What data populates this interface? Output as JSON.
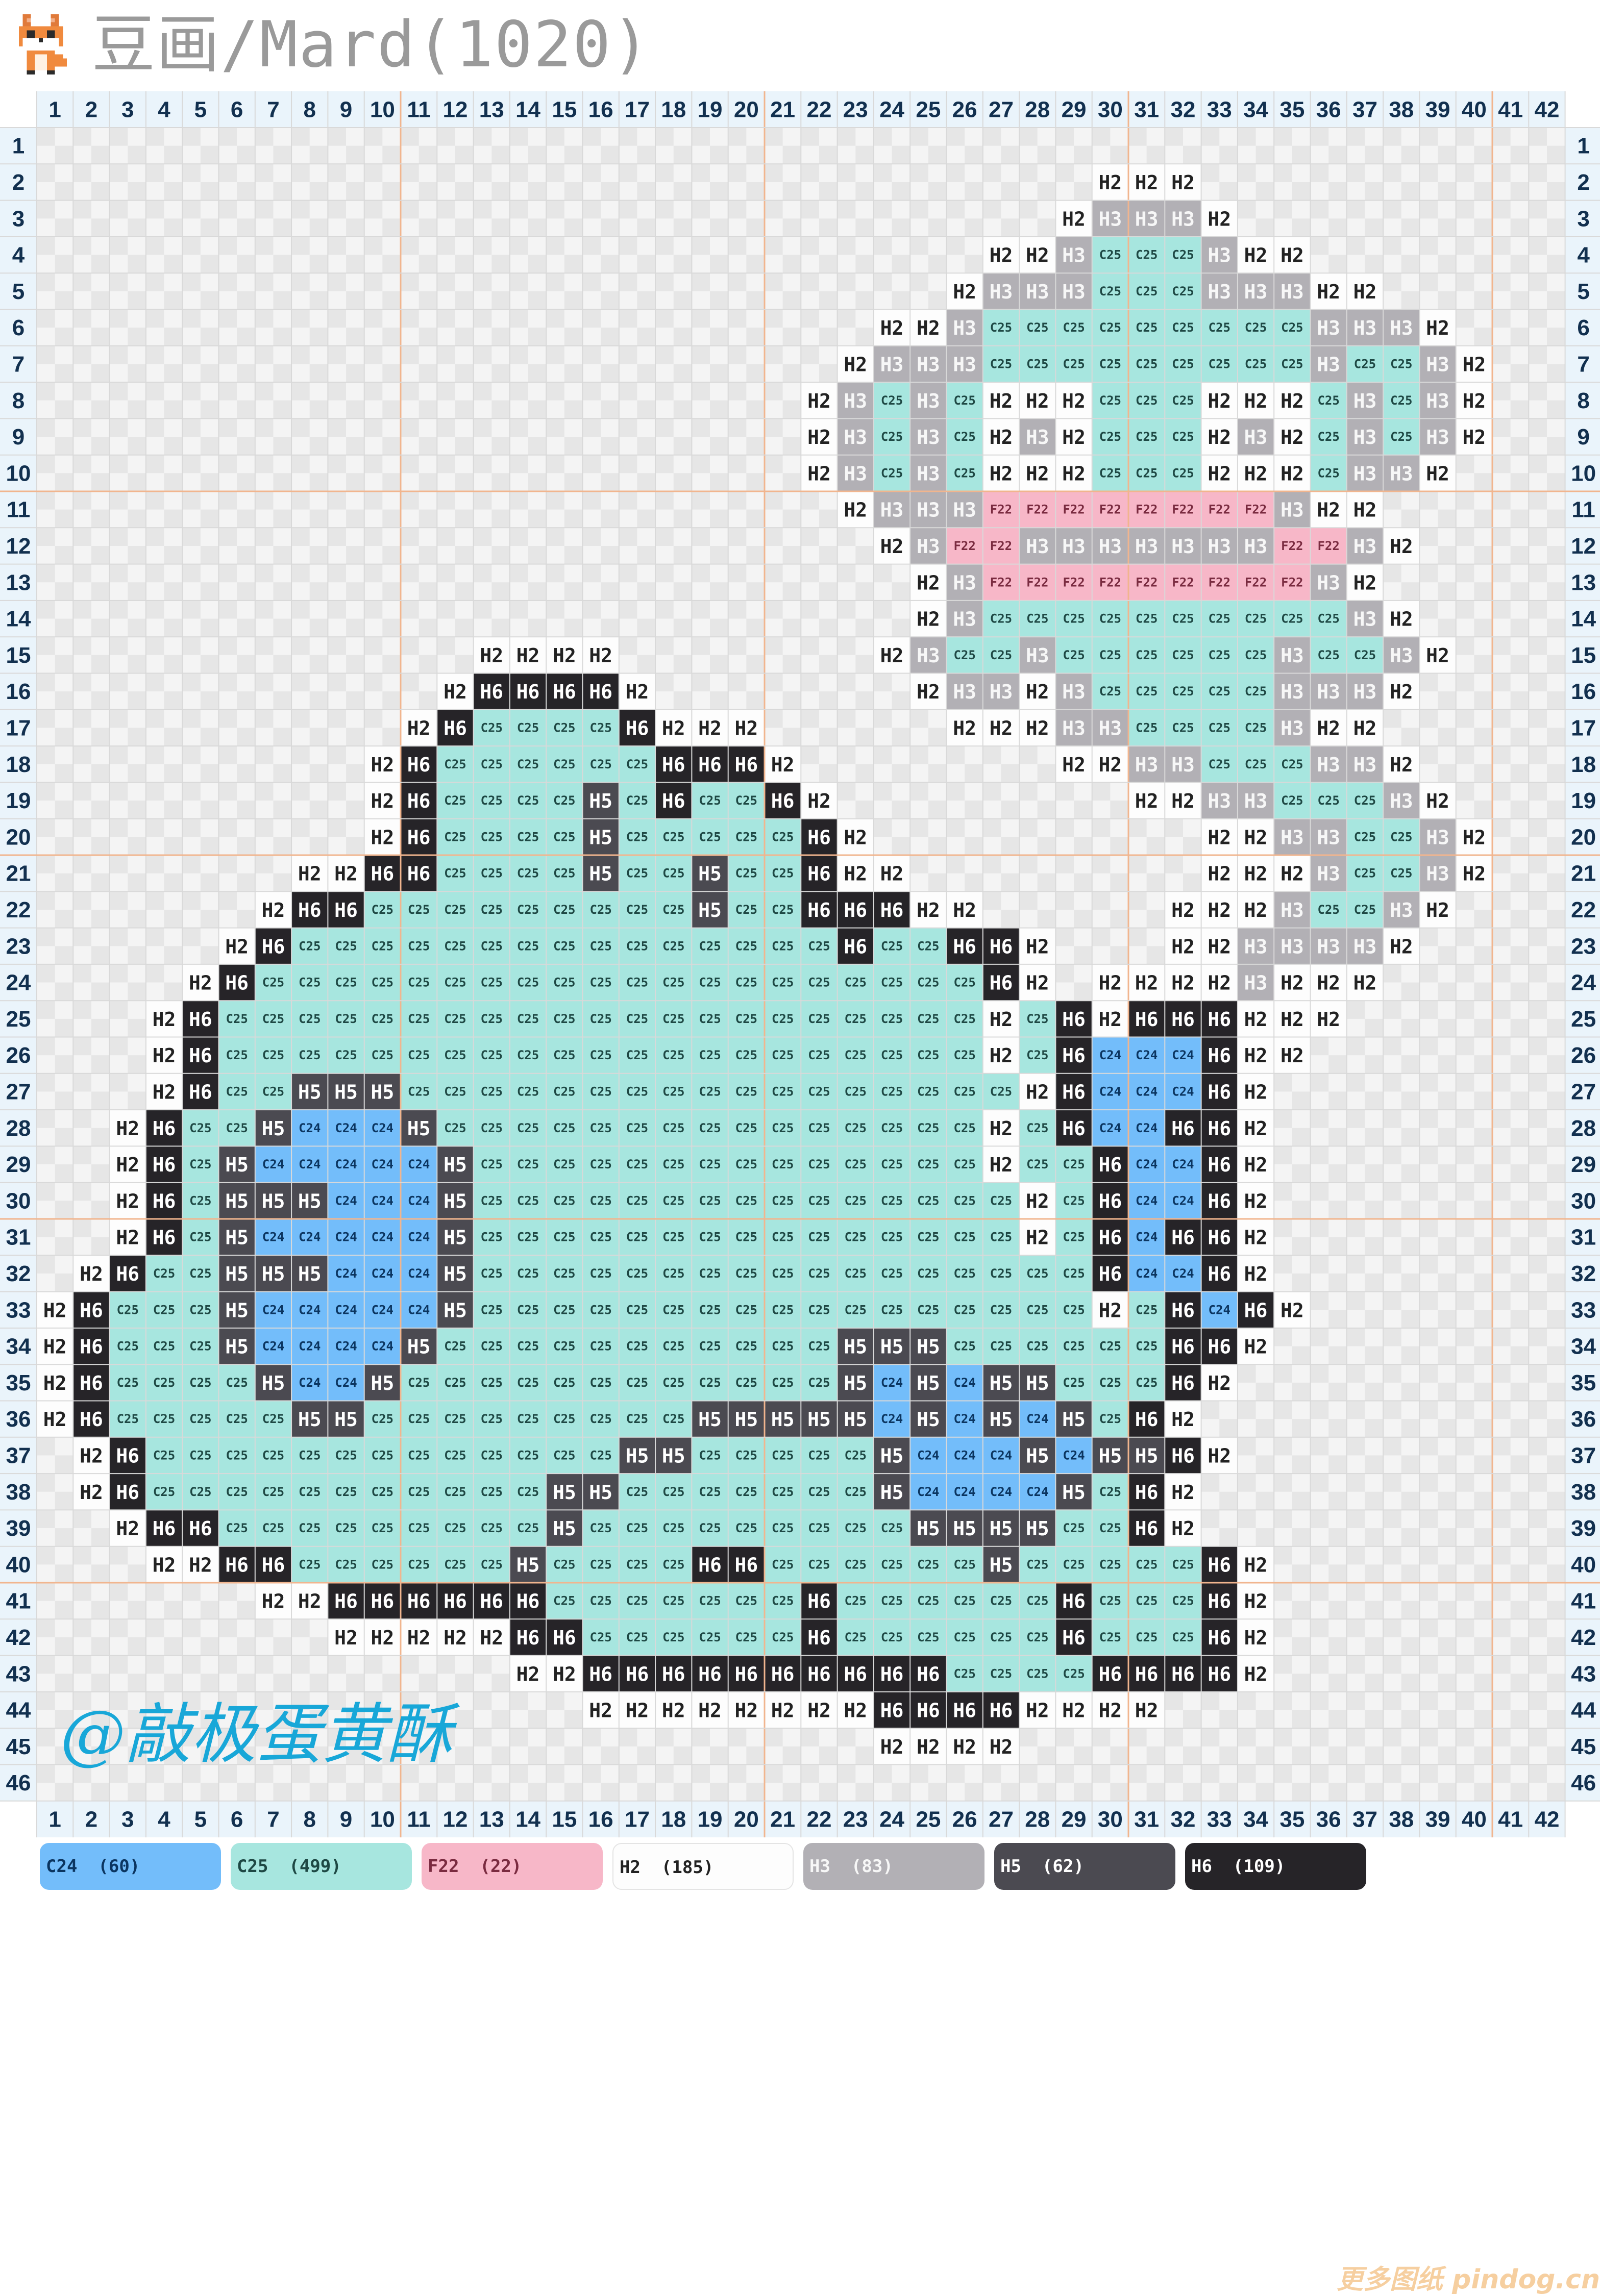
{
  "title": "豆画/Mard(1020)",
  "watermark": "@敲极蛋黄酥",
  "footer": "更多图纸 pindog.cn",
  "grid": {
    "columns": 42,
    "rows": 46,
    "col_numbers": [
      "1",
      "2",
      "3",
      "4",
      "5",
      "6",
      "7",
      "8",
      "9",
      "10",
      "11",
      "12",
      "13",
      "14",
      "15",
      "16",
      "17",
      "18",
      "19",
      "20",
      "21",
      "22",
      "23",
      "24",
      "25",
      "26",
      "27",
      "28",
      "29",
      "30",
      "31",
      "32",
      "33",
      "34",
      "35",
      "36",
      "37",
      "38",
      "39",
      "40",
      "41",
      "42"
    ],
    "row_numbers": [
      "1",
      "2",
      "3",
      "4",
      "5",
      "6",
      "7",
      "8",
      "9",
      "10",
      "11",
      "12",
      "13",
      "14",
      "15",
      "16",
      "17",
      "18",
      "19",
      "20",
      "21",
      "22",
      "23",
      "24",
      "25",
      "26",
      "27",
      "28",
      "29",
      "30",
      "31",
      "32",
      "33",
      "34",
      "35",
      "36",
      "37",
      "38",
      "39",
      "40",
      "41",
      "42",
      "43",
      "44",
      "45",
      "46"
    ],
    "rows_data": [
      "",
      "30:H2,H2,H2",
      "29:H2,H3,H3,H3,H2",
      "27:H2,H2,H3,C25,C25,C25,H3,H2,H2",
      "26:H2,H3,H3,H3,C25,C25,C25,H3,H3,H3,H2,H2",
      "24:H2,H2,H3,C25,C25,C25,C25,C25,C25,C25,C25,C25,H3,H3,H3,H2",
      "23:H2,H3,H3,H3,C25,C25,C25,C25,C25,C25,C25,C25,C25,H3,C25,C25,H3,H2",
      "22:H2,H3,C25,H3,C25,H2,H2,H2,C25,C25,C25,H2,H2,H2,C25,H3,C25,H3,H2",
      "22:H2,H3,C25,H3,C25,H2,H3,H2,C25,C25,C25,H2,H3,H2,C25,H3,C25,H3,H2",
      "22:H2,H3,C25,H3,C25,H2,H2,H2,C25,C25,C25,H2,H2,H2,C25,H3,H3,H2",
      "23:H2,H3,H3,H3,F22,F22,F22,F22,F22,F22,F22,F22,H3,H2,H2",
      "24:H2,H3,F22,F22,H3,H3,H3,H3,H3,H3,H3,F22,F22,H3,H2",
      "25:H2,H3,F22,F22,F22,F22,F22,F22,F22,F22,F22,H3,H2",
      "25:H2,H3,C25,C25,C25,C25,C25,C25,C25,C25,C25,C25,H3,H2",
      "13:H2,H2,H2,H2|24:H2,H3,C25,C25,H3,C25,C25,C25,C25,C25,C25,H3,C25,C25,H3,H2",
      "12:H2,H6,H6,H6,H6,H2|25:H2,H3,H3,H2,H3,C25,C25,C25,C25,C25,H3,H3,H3,H2",
      "11:H2,H6,C25,C25,C25,C25,H6,H2,H2,H2|26:H2,H2,H2,H3,H3,C25,C25,C25,C25,H3,H2,H2",
      "10:H2,H6,C25,C25,C25,C25,C25,C25,H6,H6,H6,H2|29:H2,H2,H3,H3,C25,C25,C25,H3,H3,H2",
      "10:H2,H6,C25,C25,C25,C25,H5,C25,H6,C25,C25,H6,H2|31:H2,H2,H3,H3,C25,C25,C25,H3,H2",
      "10:H2,H6,C25,C25,C25,C25,H5,C25,C25,C25,C25,C25,H6,H2|33:H2,H2,H3,H3,C25,C25,H3,H2",
      "8:H2,H2,H6,H6,C25,C25,C25,C25,H5,C25,C25,H5,C25,C25,H6,H2,H2|33:H2,H2,H2,H3,C25,C25,H3,H2",
      "7:H2,H6,H6,C25,C25,C25,C25,C25,C25,C25,C25,C25,H5,C25,C25,H6,H6,H6,H2,H2|32:H2,H2,H2,H3,C25,C25,H3,H2",
      "6:H2,H6,C25,C25,C25,C25,C25,C25,C25,C25,C25,C25,C25,C25,C25,C25,C25,H6,C25,C25,H6,H6,H2|32:H2,H2,H3,H3,H3,H3,H2",
      "5:H2,H6,C25,C25,C25,C25,C25,C25,C25,C25,C25,C25,C25,C25,C25,C25,C25,C25,C25,C25,C25,C25,H6,H2|30:H2,H2,H2,H2,H3,H2,H2,H2",
      "4:H2,H6,C25,C25,C25,C25,C25,C25,C25,C25,C25,C25,C25,C25,C25,C25,C25,C25,C25,C25,C25,C25,C25,H2,C25,H6,H2,H6,H6,H6,H2,H2,H2",
      "4:H2,H6,C25,C25,C25,C25,C25,C25,C25,C25,C25,C25,C25,C25,C25,C25,C25,C25,C25,C25,C25,C25,C25,H2,C25,H6,C24,C24,C24,H6,H2,H2",
      "4:H2,H6,C25,C25,H5,H5,H5,C25,C25,C25,C25,C25,C25,C25,C25,C25,C25,C25,C25,C25,C25,C25,C25,C25,H2,H6,C24,C24,C24,H6,H2",
      "3:H2,H6,C25,C25,H5,C24,C24,C24,H5,C25,C25,C25,C25,C25,C25,C25,C25,C25,C25,C25,C25,C25,C25,C25,H2,C25,H6,C24,C24,H6,H6,H2",
      "3:H2,H6,C25,H5,C24,C24,C24,C24,C24,H5,C25,C25,C25,C25,C25,C25,C25,C25,C25,C25,C25,C25,C25,C25,H2,C25,C25,H6,C24,C24,H6,H2",
      "3:H2,H6,C25,H5,H5,H5,C24,C24,C24,H5,C25,C25,C25,C25,C25,C25,C25,C25,C25,C25,C25,C25,C25,C25,C25,H2,C25,H6,C24,C24,H6,H2",
      "3:H2,H6,C25,H5,C24,C24,C24,C24,C24,H5,C25,C25,C25,C25,C25,C25,C25,C25,C25,C25,C25,C25,C25,C25,C25,H2,C25,H6,C24,H6,H6,H2",
      "2:H2,H6,C25,C25,H5,H5,H5,C24,C24,C24,H5,C25,C25,C25,C25,C25,C25,C25,C25,C25,C25,C25,C25,C25,C25,C25,C25,C25,H6,C24,C24,H6,H2",
      "1:H2,H6,C25,C25,C25,H5,C24,C24,C24,C24,C24,H5,C25,C25,C25,C25,C25,C25,C25,C25,C25,C25,C25,C25,C25,C25,C25,C25,C25,H2,C25,H6,C24,H6,H2",
      "1:H2,H6,C25,C25,C25,H5,C24,C24,C24,C24,H5,C25,C25,C25,C25,C25,C25,C25,C25,C25,C25,C25,H5,H5,H5,C25,C25,C25,C25,C25,C25,H6,H6,H2",
      "1:H2,H6,C25,C25,C25,C25,H5,C24,C24,H5,C25,C25,C25,C25,C25,C25,C25,C25,C25,C25,C25,C25,H5,C24,H5,C24,H5,H5,C25,C25,C25,H6,H2",
      "1:H2,H6,C25,C25,C25,C25,C25,H5,H5,C25,C25,C25,C25,C25,C25,C25,C25,C25,H5,H5,H5,H5,H5,C24,H5,C24,H5,C24,H5,C25,H6,H2",
      "2:H2,H6,C25,C25,C25,C25,C25,C25,C25,C25,C25,C25,C25,C25,C25,H5,H5,C25,C25,C25,C25,C25,H5,C24,C24,C24,H5,C24,H5,H5,H6,H2",
      "2:H2,H6,C25,C25,C25,C25,C25,C25,C25,C25,C25,C25,C25,H5,H5,C25,C25,C25,C25,C25,C25,C25,H5,C24,C24,C24,C24,H5,C25,H6,H2",
      "3:H2,H6,H6,C25,C25,C25,C25,C25,C25,C25,C25,C25,H5,C25,C25,C25,C25,C25,C25,C25,C25,C25,H5,H5,H5,H5,C25,C25,H6,H2",
      "4:H2,H2,H6,H6,C25,C25,C25,C25,C25,C25,H5,C25,C25,C25,C25,H6,H6,C25,C25,C25,C25,C25,C25,H5,C25,C25,C25,C25,C25,H6,H2",
      "7:H2,H2,H6,H6,H6,H6,H6,H6,C25,C25,C25,C25,C25,C25,C25,H6,C25,C25,C25,C25,C25,C25,H6,C25,C25,C25,H6,H2",
      "9:H2,H2,H2,H2,H2,H6,H6,C25,C25,C25,C25,C25,C25,H6,C25,C25,C25,C25,C25,C25,H6,C25,C25,C25,H6,H2",
      "14:H2,H2,H6,H6,H6,H6,H6,H6,H6,H6,H6,H6,C25,C25,C25,C25,H6,H6,H6,H6,H2",
      "16:H2,H2,H2,H2,H2,H2,H2,H2,H6,H6,H6,H6,H2,H2,H2,H2",
      "24:H2,H2,H2,H2",
      ""
    ]
  },
  "colors": {
    "C24": {
      "bg": "#73bdfa",
      "fg": "#0b3560"
    },
    "C25": {
      "bg": "#a7e6df",
      "fg": "#1e4844"
    },
    "F22": {
      "bg": "#f7b7c8",
      "fg": "#7a2b40"
    },
    "H2": {
      "bg": "#fdfdfd",
      "fg": "#222222"
    },
    "H3": {
      "bg": "#b2b0b5",
      "fg": "#f7f7f7"
    },
    "H5": {
      "bg": "#4b4a51",
      "fg": "#ffffff"
    },
    "H6": {
      "bg": "#262428",
      "fg": "#ffffff"
    },
    "board_light": "#f4f4f4",
    "board_dark": "#e6e6e6",
    "line": "#d9d9d9",
    "major_line": "#f1b58e",
    "header_bg": "#eaf4fb",
    "number": "#12304f"
  },
  "legend": [
    {
      "code": "C24",
      "count": "(60)"
    },
    {
      "code": "C25",
      "count": "(499)"
    },
    {
      "code": "F22",
      "count": "(22)"
    },
    {
      "code": "H2",
      "count": "(185)"
    },
    {
      "code": "H3",
      "count": "(83)"
    },
    {
      "code": "H5",
      "count": "(62)"
    },
    {
      "code": "H6",
      "count": "(109)"
    }
  ]
}
